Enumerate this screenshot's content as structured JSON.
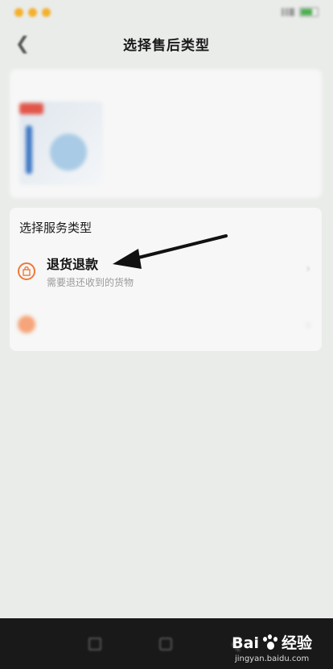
{
  "nav": {
    "back_glyph": "❮",
    "title": "选择售后类型"
  },
  "service": {
    "header": "选择服务类型",
    "refund": {
      "title": "退货退款",
      "subtitle": "需要退还收到的货物",
      "icon": "return-bag-icon"
    },
    "chevron": "›"
  },
  "watermark": {
    "main_left": "Bai",
    "main_right": "经验",
    "sub": "jingyan.baidu.com"
  },
  "colors": {
    "accent": "#f07838",
    "background": "#eaecea"
  }
}
